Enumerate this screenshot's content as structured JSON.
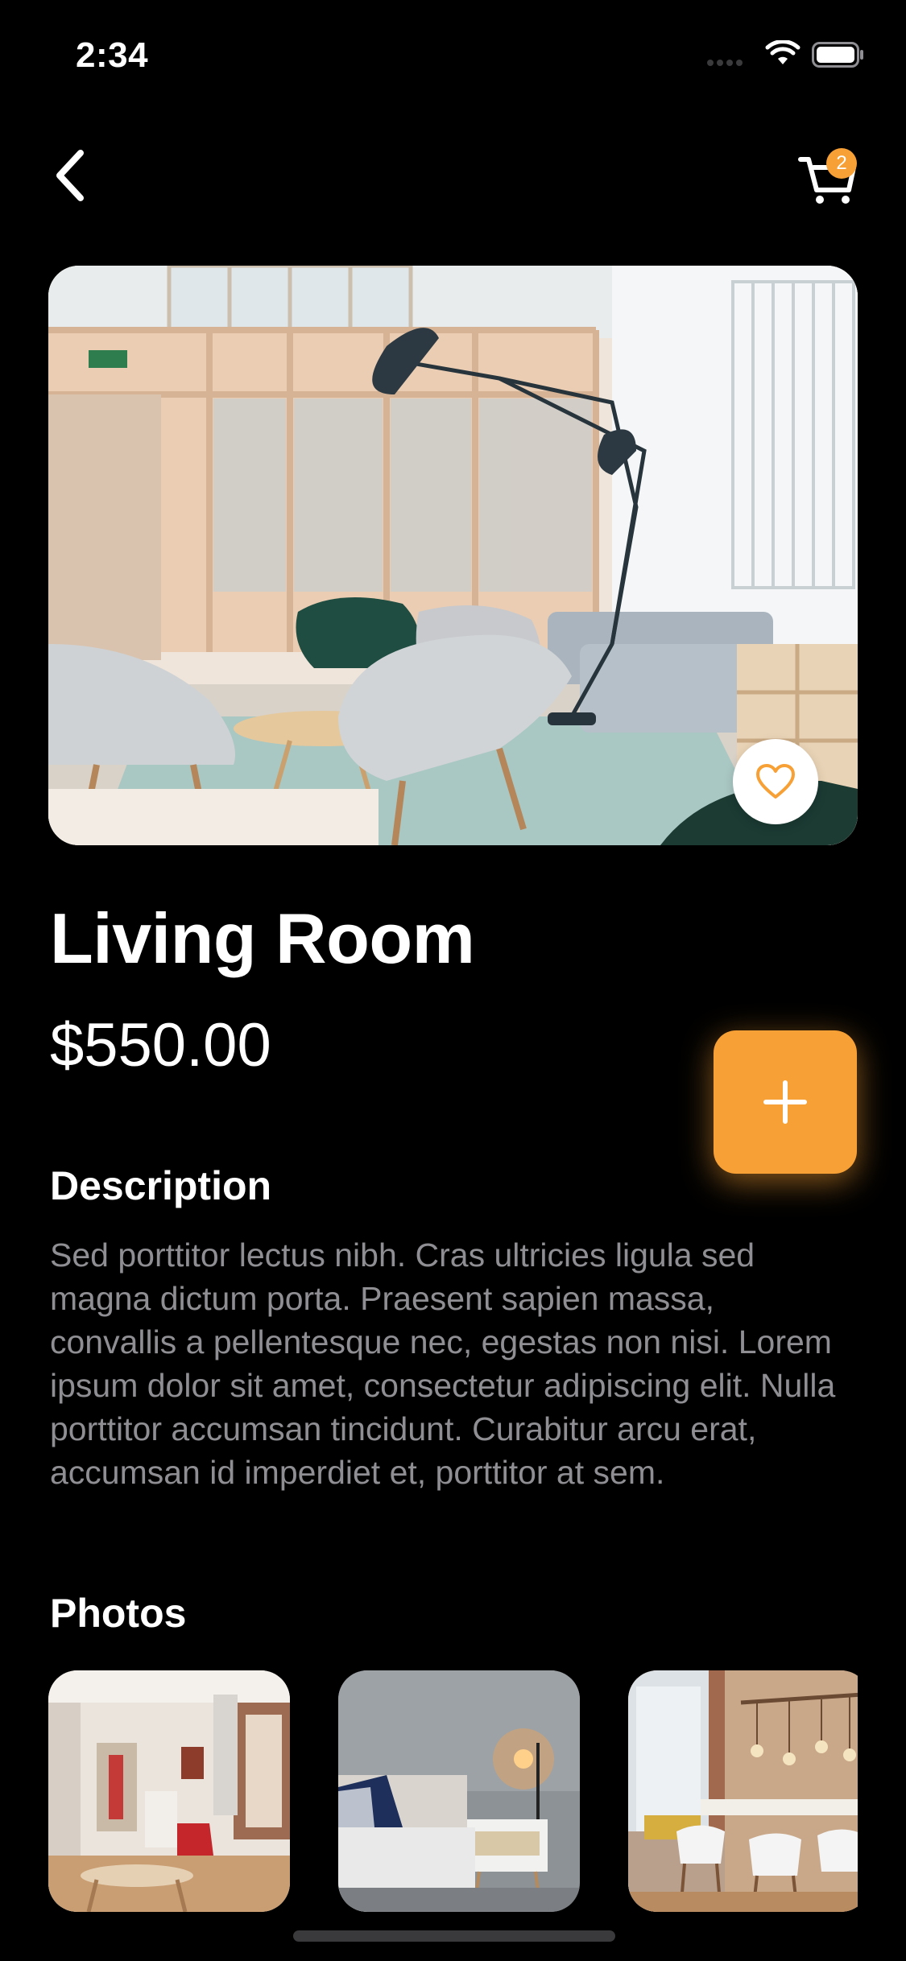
{
  "status_bar": {
    "time": "2:34"
  },
  "nav": {
    "back_icon": "chevron-left-icon",
    "cart_icon": "cart-icon",
    "cart_count": "2"
  },
  "product": {
    "title": "Living Room",
    "price": "$550.00",
    "favorite_icon": "heart-icon",
    "add_icon": "plus-icon"
  },
  "description": {
    "heading": "Description",
    "text": "Sed porttitor lectus nibh. Cras ultricies ligula sed magna dictum porta. Praesent sapien massa, convallis a pellentesque nec, egestas non nisi. Lorem ipsum dolor sit amet, consectetur adipiscing elit. Nulla porttitor accumsan tincidunt. Curabitur arcu erat, accumsan id imperdiet et, porttitor at sem."
  },
  "photos": {
    "heading": "Photos"
  },
  "colors": {
    "accent": "#f7a035",
    "background": "#000000",
    "muted_text": "#8e8e93"
  }
}
